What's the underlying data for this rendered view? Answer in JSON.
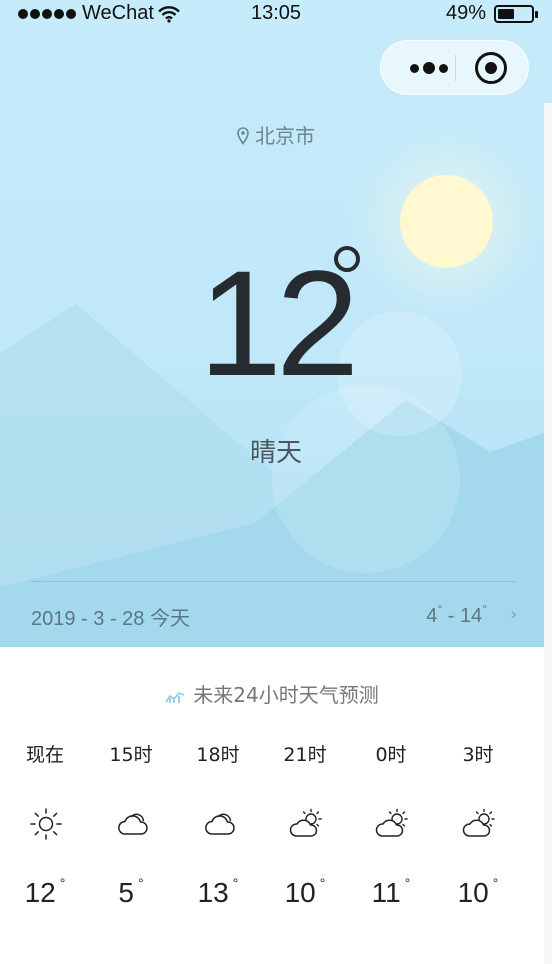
{
  "status_bar": {
    "carrier": "WeChat",
    "time": "13:05",
    "battery": "49%"
  },
  "capsule": {
    "more_icon": "more-dots-icon",
    "close_icon": "target-close-icon"
  },
  "location": "北京市",
  "current": {
    "temperature": "12",
    "condition": "晴天",
    "date": "2019 - 3 - 28 今天",
    "low": "4",
    "high": "14",
    "range_sep": " - "
  },
  "forecast": {
    "title": "未来24小时天气预测",
    "items": [
      {
        "time": "现在",
        "icon": "sunny-icon",
        "temp": "12"
      },
      {
        "time": "15时",
        "icon": "cloudy-icon",
        "temp": "5"
      },
      {
        "time": "18时",
        "icon": "cloudy-icon",
        "temp": "13"
      },
      {
        "time": "21时",
        "icon": "partly-cloudy-icon",
        "temp": "10"
      },
      {
        "time": "0时",
        "icon": "partly-cloudy-icon",
        "temp": "11"
      },
      {
        "time": "3时",
        "icon": "partly-cloudy-icon",
        "temp": "10"
      }
    ]
  },
  "colors": {
    "sky_top": "#c6ebfa",
    "sky_bottom": "#a9def1",
    "sun": "#fff8d0",
    "temp_text": "#262b2f"
  }
}
